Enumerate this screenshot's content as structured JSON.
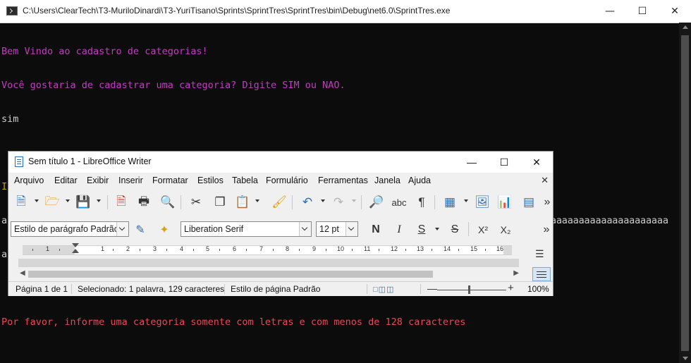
{
  "console": {
    "title": "C:\\Users\\ClearTech\\T3-MuriloDinardi\\T3-YuriTisano\\Sprints\\SprintTres\\SprintTres\\bin\\Debug\\net6.0\\SprintTres.exe",
    "lines": [
      "Bem Vindo ao cadastro de categorias!",
      "Você gostaria de cadastrar uma categoria? Digite SIM ou NAO.",
      "sim",
      "",
      "Informe o que quer cadastrar?",
      "aaaaaaaaaaaaaaaaaaaaaaaaaaaaaaaaaaaaaaaaaaaaaaaaaaaaaaaaaaaaaaaaaaaaaaaaaaaaaaaaaaaaaaaaaaaaaaaaaaaaaaaaaaaaaaaaaaaaaaa",
      "aaaaaaaaa",
      "",
      "Por favor, informe uma categoria somente com letras e com menos de 128 caracteres"
    ],
    "colors": {
      "magenta": "#c13cc2",
      "white": "#cccccc",
      "yellow": "#c19c00",
      "red": "#e74856"
    }
  },
  "writer": {
    "title": "Sem título 1 - LibreOffice Writer",
    "menu": [
      "Arquivo",
      "Editar",
      "Exibir",
      "Inserir",
      "Formatar",
      "Estilos",
      "Tabela",
      "Formulário",
      "Ferramentas",
      "Janela",
      "Ajuda"
    ],
    "paragraph_style": "Estilo de parágrafo Padrão",
    "font_name": "Liberation Serif",
    "font_size": "12 pt",
    "format_buttons": {
      "bold": "N",
      "italic": "I",
      "underline": "S",
      "strike": "S",
      "superscript": "X²",
      "subscript": "X₂"
    },
    "ruler_numbers": [
      "1",
      "1",
      "2",
      "3",
      "4",
      "5",
      "6",
      "7",
      "8",
      "9",
      "10",
      "11",
      "12",
      "13",
      "14",
      "15",
      "16"
    ],
    "status": {
      "page": "Página 1 de 1",
      "selection": "Selecionado: 1 palavra, 129 caracteres",
      "page_style": "Estilo de página Padrão",
      "zoom": "100%"
    }
  }
}
